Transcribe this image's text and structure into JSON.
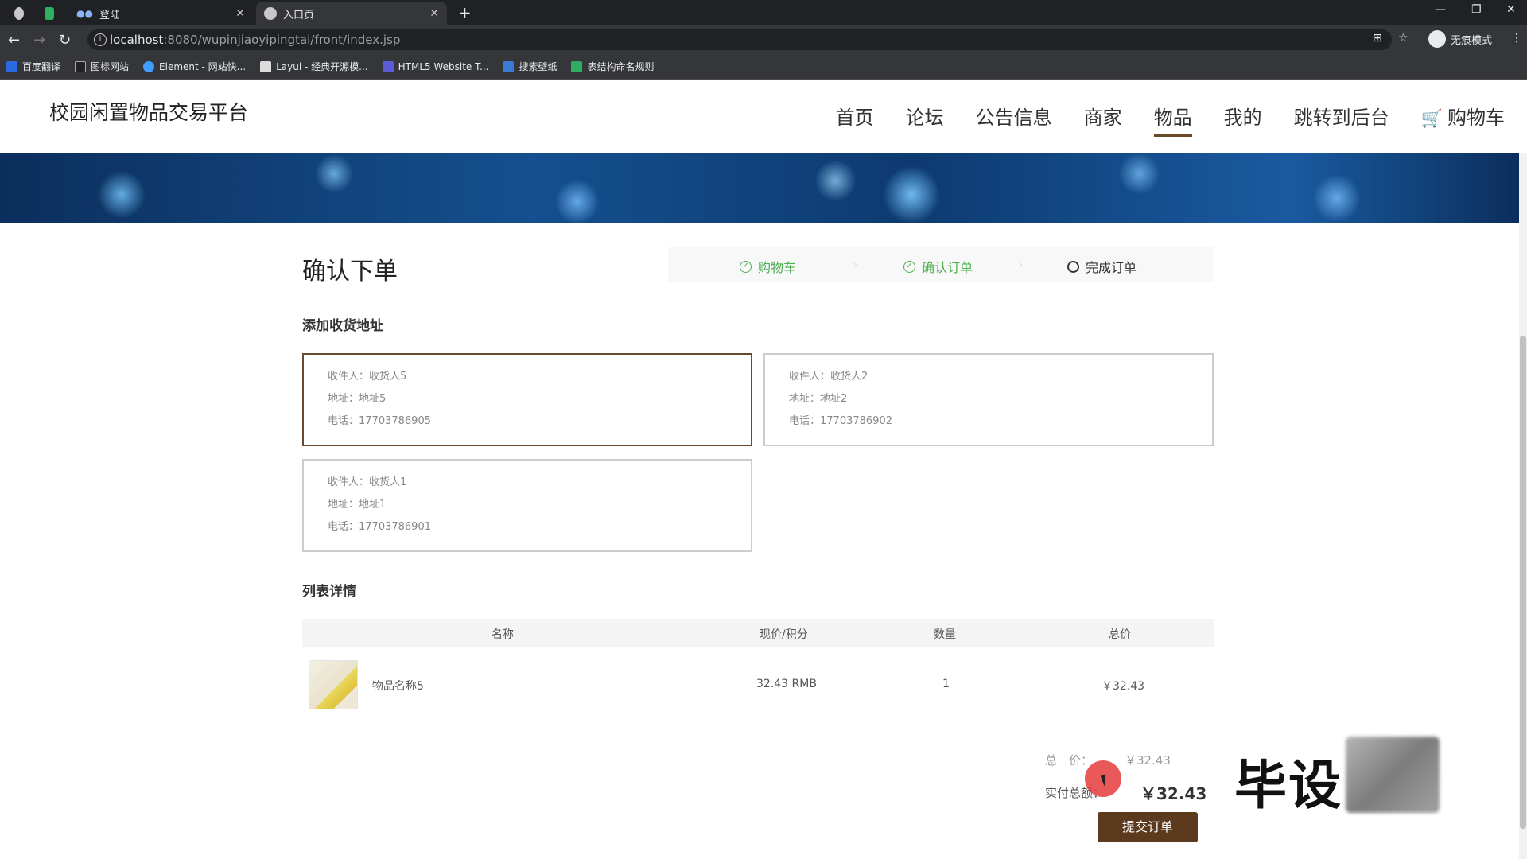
{
  "browser": {
    "tabs": [
      {
        "label": "",
        "icon": "chrome-icon"
      },
      {
        "label": "",
        "icon": "sheet-icon"
      },
      {
        "label": "登陆",
        "icon": "dots-icon"
      },
      {
        "label": "入口页",
        "icon": "globe-icon"
      }
    ],
    "url_host": "localhost",
    "url_path": ":8080/wupinjiaoyipingtai/front/index.jsp",
    "incognito_label": "无痕模式",
    "bookmarks": [
      {
        "label": "百度翻译",
        "color": "#2a6ae0"
      },
      {
        "label": "图标网站",
        "color": "#222222"
      },
      {
        "label": "Element - 网站快...",
        "color": "#409eff"
      },
      {
        "label": "Layui - 经典开源模...",
        "color": "#dddddd"
      },
      {
        "label": "HTML5 Website T...",
        "color": "#5b5bd6"
      },
      {
        "label": "搜素壁纸",
        "color": "#3a7bd5"
      },
      {
        "label": "表结构命名规则",
        "color": "#2fae63"
      }
    ]
  },
  "site": {
    "title": "校园闲置物品交易平台",
    "nav": [
      "首页",
      "论坛",
      "公告信息",
      "商家",
      "物品",
      "我的",
      "跳转到后台",
      "购物车"
    ],
    "active_nav": "物品"
  },
  "checkout": {
    "heading": "确认下单",
    "steps": [
      {
        "label": "购物车",
        "status": "done"
      },
      {
        "label": "确认订单",
        "status": "done"
      },
      {
        "label": "完成订单",
        "status": "pending"
      }
    ],
    "address_section_title": "添加收货地址",
    "addresses": [
      {
        "receiver": "收件人：收货人5",
        "address": "地址：地址5",
        "phone": "电话：17703786905",
        "selected": true
      },
      {
        "receiver": "收件人：收货人2",
        "address": "地址：地址2",
        "phone": "电话：17703786902",
        "selected": false
      },
      {
        "receiver": "收件人：收货人1",
        "address": "地址：地址1",
        "phone": "电话：17703786901",
        "selected": false
      }
    ],
    "list_section_title": "列表详情",
    "table_headers": [
      "名称",
      "现价/积分",
      "数量",
      "总价"
    ],
    "items": [
      {
        "name": "物品名称5",
        "price": "32.43 RMB",
        "quantity": "1",
        "total": "￥32.43"
      }
    ],
    "total_label": "总　价：",
    "total_value": "￥32.43",
    "final_label": "实付总额：",
    "final_value": "￥32.43",
    "submit_label": "提交订单"
  },
  "overlay": {
    "watermark_text": "毕设"
  },
  "colors": {
    "accent_brown": "#5c3a1e",
    "step_done_green": "#4caf50",
    "selected_border": "#6a4a2e"
  }
}
